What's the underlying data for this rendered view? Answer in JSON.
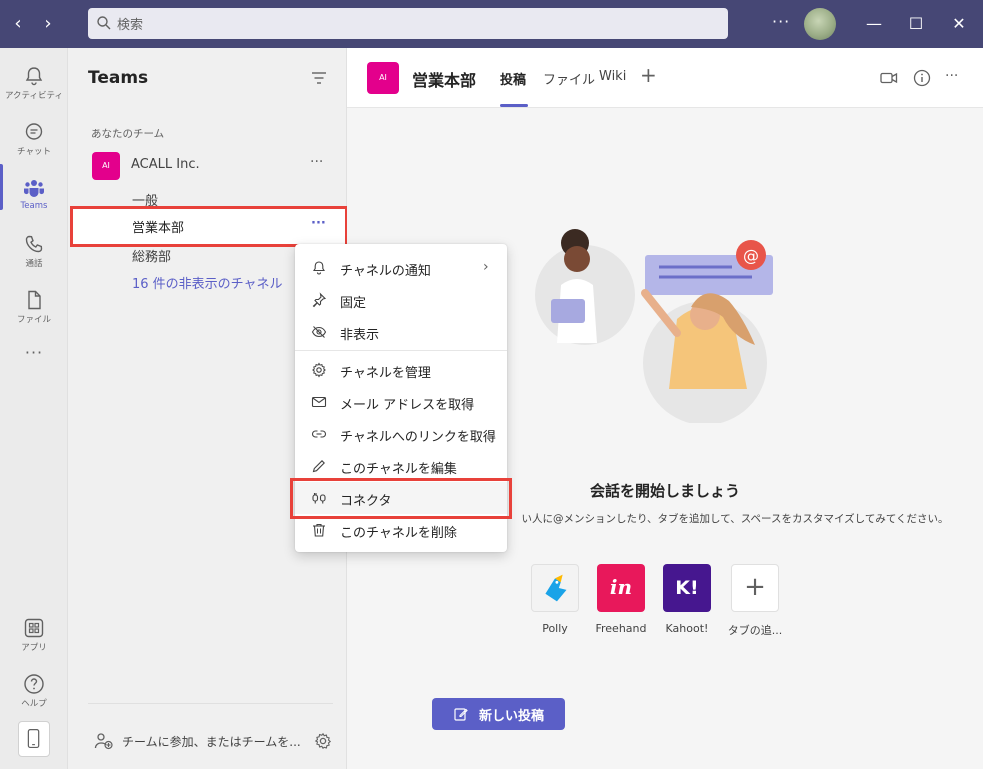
{
  "titlebar": {
    "search_placeholder": "検索",
    "back_glyph": "‹",
    "forward_glyph": "›",
    "more_glyph": "···",
    "minimize_glyph": "—",
    "maximize_glyph": "☐",
    "close_glyph": "✕"
  },
  "rail": {
    "items": [
      {
        "label": "アクティビティ",
        "icon": "bell-icon"
      },
      {
        "label": "チャット",
        "icon": "chat-icon"
      },
      {
        "label": "Teams",
        "icon": "teams-icon",
        "active": true
      },
      {
        "label": "通話",
        "icon": "phone-icon"
      },
      {
        "label": "ファイル",
        "icon": "file-icon"
      }
    ],
    "more_glyph": "···",
    "apps_label": "アプリ",
    "help_label": "ヘルプ"
  },
  "teams_panel": {
    "title": "Teams",
    "section_label": "あなたのチーム",
    "team": {
      "avatar": "AI",
      "name": "ACALL Inc.",
      "more_glyph": "···"
    },
    "channels": [
      "一般",
      "営業本部",
      "総務部"
    ],
    "selected_channel": "営業本部",
    "selected_more_glyph": "···",
    "hidden_channels_link": "16 件の非表示のチャネル",
    "join_label": "チームに参加、またはチームを..."
  },
  "channel_header": {
    "avatar": "AI",
    "title": "営業本部",
    "tabs": [
      "投稿",
      "ファイル",
      "Wiki"
    ],
    "active_tab": "投稿",
    "add_tab_glyph": "+",
    "more_glyph": "···"
  },
  "context_menu": {
    "items": [
      {
        "label": "チャネルの通知",
        "icon": "bell-icon",
        "submenu": true
      },
      {
        "label": "固定",
        "icon": "pin-icon"
      },
      {
        "label": "非表示",
        "icon": "eye-off-icon"
      },
      {
        "label": "チャネルを管理",
        "icon": "gear-icon"
      },
      {
        "label": "メール アドレスを取得",
        "icon": "mail-icon"
      },
      {
        "label": "チャネルへのリンクを取得",
        "icon": "link-icon"
      },
      {
        "label": "このチャネルを編集",
        "icon": "pencil-icon"
      },
      {
        "label": "コネクタ",
        "icon": "connector-icon",
        "highlighted": true
      },
      {
        "label": "このチャネルを削除",
        "icon": "trash-icon"
      }
    ],
    "chevron_glyph": "›"
  },
  "main": {
    "welcome_title": "会話を開始しましょう",
    "welcome_subtitle": "い人に@メンションしたり、タブを追加して、スペースをカスタマイズしてみてください。",
    "apps": [
      {
        "label": "Polly",
        "color": "#f3f3f3"
      },
      {
        "label": "Freehand",
        "color": "#e8185b",
        "glyph": "in"
      },
      {
        "label": "Kahoot!",
        "color": "#46178f",
        "glyph": "K!"
      },
      {
        "label": "タブの追...",
        "color": "#ffffff",
        "glyph": "+"
      }
    ],
    "new_post_label": "新しい投稿"
  },
  "colors": {
    "titlebar": "#464775",
    "brand": "#5b5fc7",
    "team_avatar": "#e3008c",
    "highlight": "#e8413a"
  }
}
